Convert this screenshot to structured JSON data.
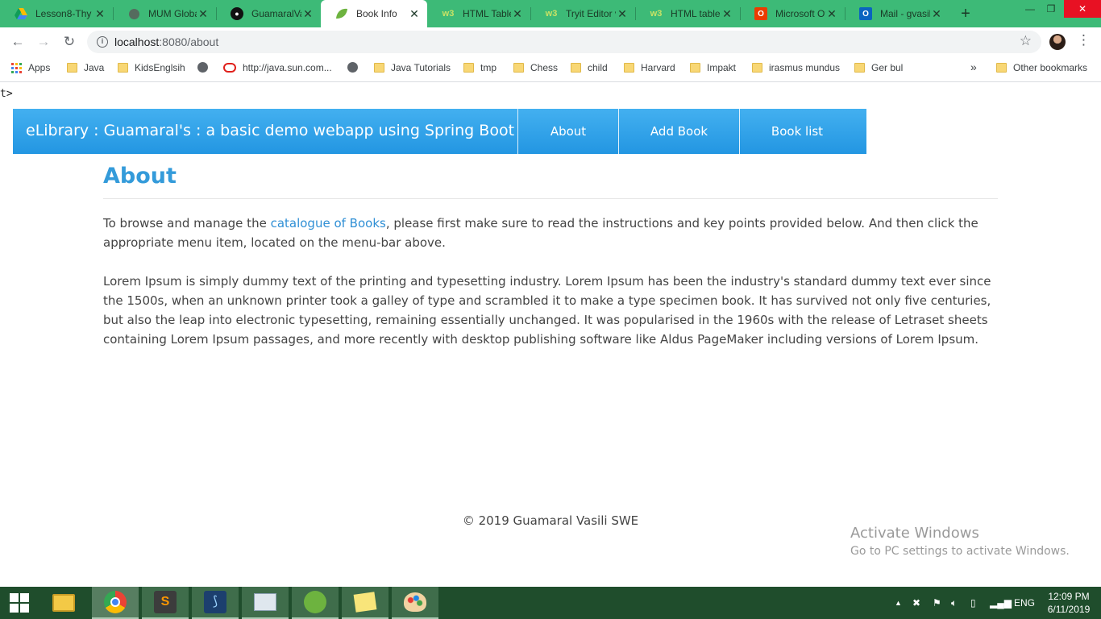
{
  "browser": {
    "tabs": [
      {
        "title": "Lesson8-Thy",
        "icon": "google-drive-icon",
        "active": false
      },
      {
        "title": "MUM Globa",
        "icon": "globe-icon",
        "active": false
      },
      {
        "title": "GuamaralVa",
        "icon": "github-icon",
        "active": false
      },
      {
        "title": "Book Info",
        "icon": "spring-leaf-icon",
        "active": true
      },
      {
        "title": "HTML Table",
        "icon": "w3schools-icon",
        "active": false
      },
      {
        "title": "Tryit Editor v",
        "icon": "w3schools-icon",
        "active": false
      },
      {
        "title": "HTML table",
        "icon": "w3schools-icon",
        "active": false
      },
      {
        "title": "Microsoft Of",
        "icon": "office-icon",
        "active": false
      },
      {
        "title": "Mail - gvasil",
        "icon": "outlook-icon",
        "active": false
      }
    ],
    "url": {
      "host": "localhost",
      "path": ":8080/about"
    },
    "bookmarks": [
      {
        "label": "Apps",
        "icon": "apps-grid-icon"
      },
      {
        "label": "Java",
        "icon": "folder-icon"
      },
      {
        "label": "KidsEnglsih",
        "icon": "folder-icon"
      },
      {
        "label": "",
        "icon": "globe-icon"
      },
      {
        "label": "http://java.sun.com...",
        "icon": "oracle-icon"
      },
      {
        "label": "",
        "icon": "globe-icon"
      },
      {
        "label": "Java Tutorials",
        "icon": "folder-icon"
      },
      {
        "label": "tmp",
        "icon": "folder-icon"
      },
      {
        "label": "Chess",
        "icon": "folder-icon"
      },
      {
        "label": "child",
        "icon": "folder-icon"
      },
      {
        "label": "Harvard",
        "icon": "folder-icon"
      },
      {
        "label": "Impakt",
        "icon": "folder-icon"
      },
      {
        "label": "irasmus mundus",
        "icon": "folder-icon"
      },
      {
        "label": "Ger bul",
        "icon": "folder-icon"
      }
    ],
    "more_chevron": "»",
    "other_bookmarks": "Other bookmarks"
  },
  "page": {
    "stray_text": "t>",
    "brand": "eLibrary : Guamaral's : a basic demo webapp using Spring Boot",
    "nav": [
      "About",
      "Add Book",
      "Book list"
    ],
    "heading": "About",
    "intro_before": "To browse and manage the ",
    "intro_link": "catalogue of Books",
    "intro_after": ", please first make sure to read the instructions and key points provided below. And then click the appropriate menu item, located on the menu-bar above.",
    "lorem": "Lorem Ipsum is simply dummy text of the printing and typesetting industry. Lorem Ipsum has been the industry's standard dummy text ever since the 1500s, when an unknown printer took a galley of type and scrambled it to make a type specimen book. It has survived not only five centuries, but also the leap into electronic typesetting, remaining essentially unchanged. It was popularised in the 1960s with the release of Letraset sheets containing Lorem Ipsum passages, and more recently with desktop publishing software like Aldus PageMaker including versions of Lorem Ipsum.",
    "footer": "© 2019 Guamaral Vasili SWE",
    "watermark_title": "Activate Windows",
    "watermark_sub": "Go to PC settings to activate Windows."
  },
  "taskbar": {
    "apps": [
      {
        "name": "file-explorer-icon"
      },
      {
        "name": "chrome-icon"
      },
      {
        "name": "sublime-text-icon"
      },
      {
        "name": "mysql-workbench-icon"
      },
      {
        "name": "task-manager-icon"
      },
      {
        "name": "spring-tool-suite-icon"
      },
      {
        "name": "sticky-notes-icon"
      },
      {
        "name": "paint-icon"
      }
    ],
    "language": "ENG",
    "time": "12:09 PM",
    "date": "6/11/2019"
  },
  "colors": {
    "tabstrip": "#3dba77",
    "navbar": "#2e9fe6",
    "heading": "#349bda",
    "link": "#2f8fd5",
    "taskbar": "#1f4d2c"
  }
}
